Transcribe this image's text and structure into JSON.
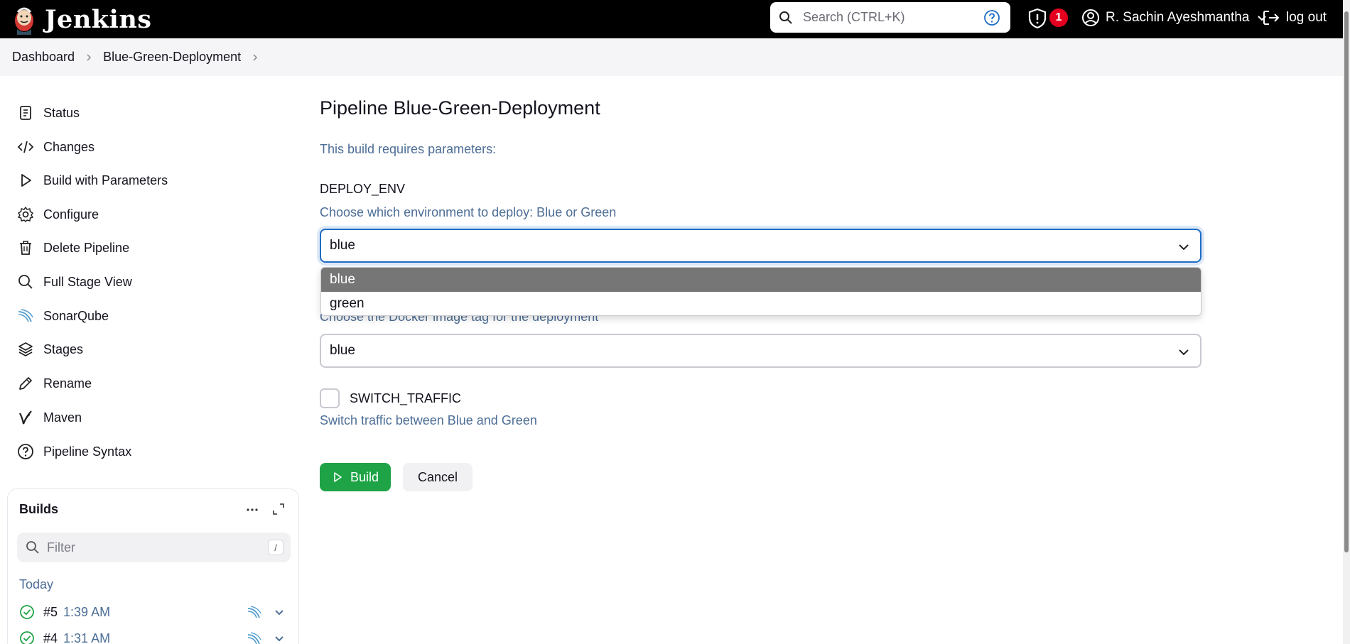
{
  "header": {
    "brand": "Jenkins",
    "search_placeholder": "Search (CTRL+K)",
    "notification_count": "1",
    "user_name": "R. Sachin Ayeshmantha",
    "logout_label": "log out"
  },
  "breadcrumb": [
    "Dashboard",
    "Blue-Green-Deployment"
  ],
  "sidebar": {
    "items": [
      {
        "label": "Status",
        "icon": "document-icon"
      },
      {
        "label": "Changes",
        "icon": "code-icon"
      },
      {
        "label": "Build with Parameters",
        "icon": "play-icon"
      },
      {
        "label": "Configure",
        "icon": "gear-icon"
      },
      {
        "label": "Delete Pipeline",
        "icon": "trash-icon"
      },
      {
        "label": "Full Stage View",
        "icon": "search-icon"
      },
      {
        "label": "SonarQube",
        "icon": "sonarqube-icon"
      },
      {
        "label": "Stages",
        "icon": "layers-icon"
      },
      {
        "label": "Rename",
        "icon": "pencil-icon"
      },
      {
        "label": "Maven",
        "icon": "maven-icon"
      },
      {
        "label": "Pipeline Syntax",
        "icon": "help-icon"
      }
    ]
  },
  "builds": {
    "title": "Builds",
    "filter_placeholder": "Filter",
    "filter_shortcut": "/",
    "group_label": "Today",
    "items": [
      {
        "number": "#5",
        "time": "1:39 AM"
      },
      {
        "number": "#4",
        "time": "1:31 AM"
      }
    ]
  },
  "main": {
    "title": "Pipeline Blue-Green-Deployment",
    "requires_text": "This build requires parameters:",
    "deploy_env": {
      "name": "DEPLOY_ENV",
      "description": "Choose which environment to deploy: Blue or Green",
      "value": "blue",
      "options": [
        "blue",
        "green"
      ]
    },
    "image_tag": {
      "description": "Choose the Docker image tag for the deployment",
      "value": "blue"
    },
    "switch_traffic": {
      "name": "SWITCH_TRAFFIC",
      "description": "Switch traffic between Blue and Green"
    },
    "build_label": "Build",
    "cancel_label": "Cancel"
  },
  "colors": {
    "header_bg": "#000000",
    "accent_blue": "#1f6dc4",
    "build_green": "#1ea446",
    "badge_red": "#e6001f",
    "muted_text": "#4d6e96"
  }
}
